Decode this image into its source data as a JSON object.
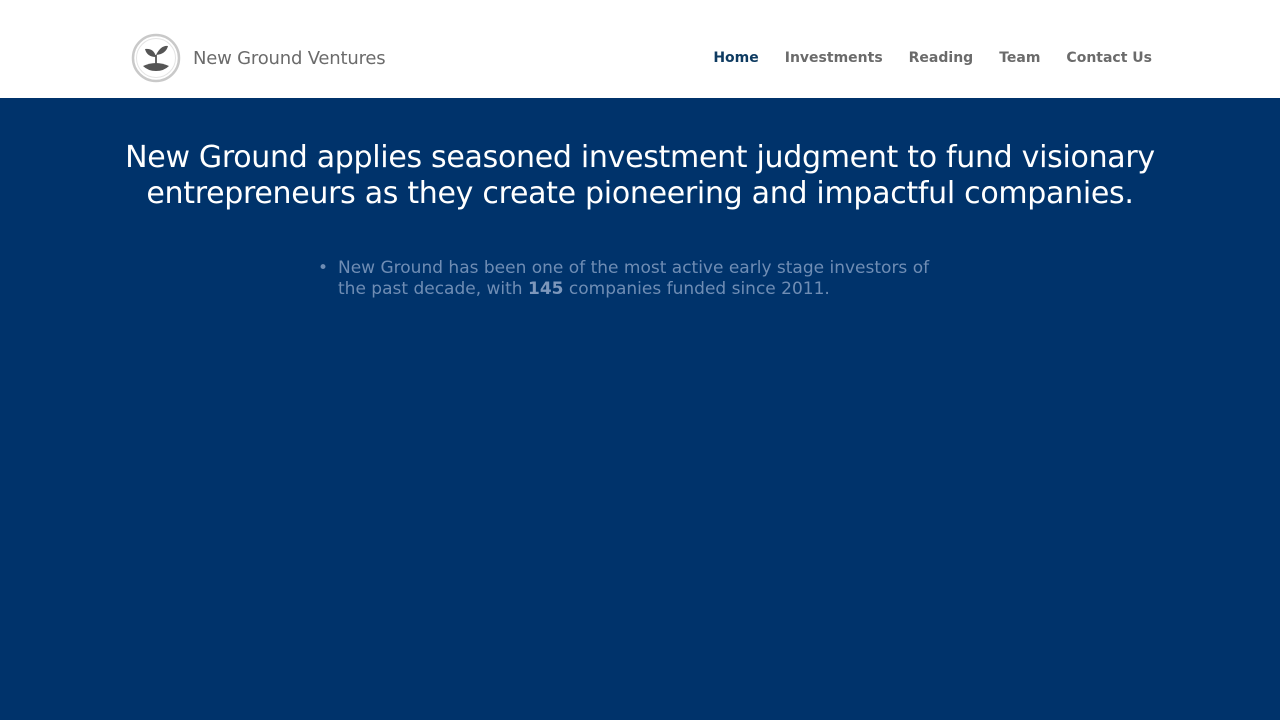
{
  "brand": {
    "name": "New Ground Ventures",
    "logo_icon": "sprout-icon"
  },
  "nav": {
    "items": [
      {
        "label": "Home",
        "active": true
      },
      {
        "label": "Investments",
        "active": false
      },
      {
        "label": "Reading",
        "active": false
      },
      {
        "label": "Team",
        "active": false
      },
      {
        "label": "Contact Us",
        "active": false
      }
    ]
  },
  "hero": {
    "headline": "New Ground applies seasoned investment judgment to fund visionary entrepreneurs as they create pioneering and impactful companies.",
    "facts": [
      {
        "bullet": "•",
        "text_before": "New Ground has been one of the most active early stage investors of the past decade, with ",
        "highlight": "145",
        "text_after": " companies funded since 2011."
      }
    ]
  },
  "colors": {
    "hero_background": "#00336b",
    "nav_active": "#0e3b61",
    "nav_default": "#6b6b6b",
    "headline": "#ffffff",
    "fact_text": "#6f8db4"
  }
}
